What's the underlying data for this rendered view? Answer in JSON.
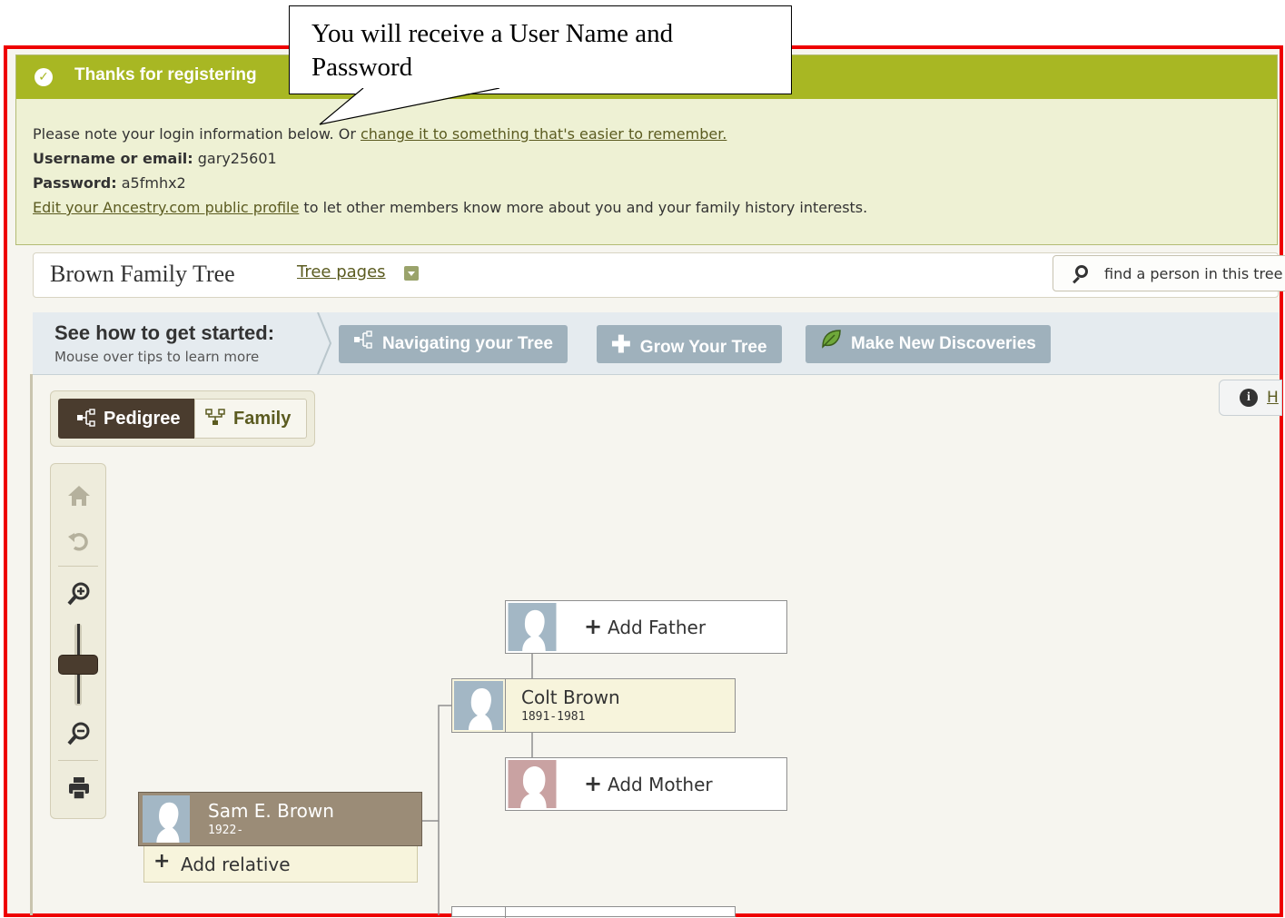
{
  "callout": {
    "text_line1": "You will receive a User Name and",
    "text_line2": "Password"
  },
  "banner": {
    "title": "Thanks for registering",
    "note_prefix": "Please note your login information below. Or ",
    "note_link": "change it to something that's easier to remember.",
    "username_label": "Username or email:",
    "username_value": " gary25601",
    "password_label": "Password:",
    "password_value": " a5fmhx2",
    "profile_link": "Edit your Ancestry.com public profile",
    "profile_suffix": " to let other members know more about you and your family history interests."
  },
  "header": {
    "tree_name": "Brown Family Tree",
    "tree_pages": "Tree pages",
    "search_placeholder": "find a person in this tree"
  },
  "get_started": {
    "title": "See how to get started:",
    "subtitle": "Mouse over tips to learn more",
    "tips": [
      {
        "label": "Navigating your Tree",
        "icon": "pedigree-icon"
      },
      {
        "label": "Grow Your Tree",
        "icon": "plus-icon"
      },
      {
        "label": "Make New Discoveries",
        "icon": "leaf-icon"
      }
    ]
  },
  "help_tab": {
    "label": "H"
  },
  "view_toggle": {
    "pedigree": "Pedigree",
    "family": "Family",
    "active": "Pedigree"
  },
  "zoom_controls": {
    "icons": [
      "home-icon",
      "undo-icon",
      "zoom-in-icon",
      "zoom-slider",
      "zoom-out-icon",
      "print-icon"
    ]
  },
  "tree": {
    "root": {
      "name": "Sam E. Brown",
      "dates": "1922-"
    },
    "add_relative": "Add relative",
    "father": {
      "name": "Colt Brown",
      "dates": "1891-1981"
    },
    "add_father": "Add Father",
    "add_mother": "Add Mother"
  },
  "colors": {
    "banner_green": "#a8b723",
    "root_person": "#9b8c77",
    "frame_red": "#ee0000",
    "tip_button": "#9fb1bc"
  }
}
